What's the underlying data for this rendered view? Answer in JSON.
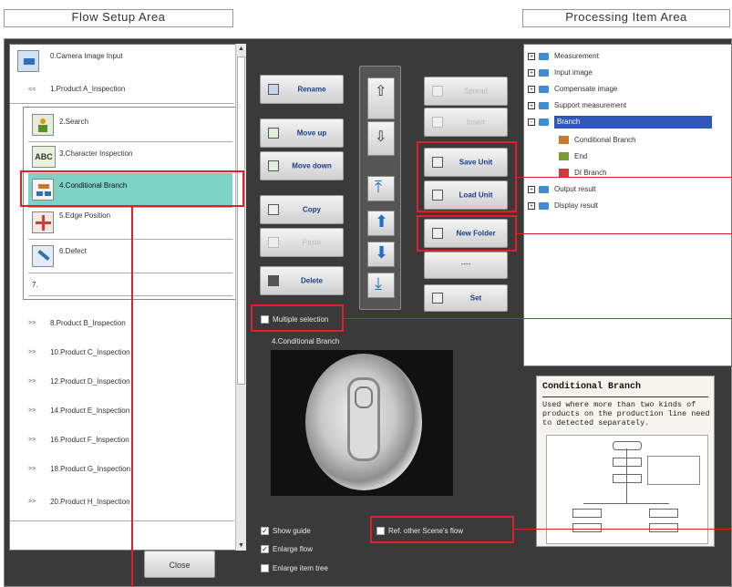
{
  "areas": {
    "flow_setup": "Flow Setup Area",
    "processing_item": "Processing Item Area"
  },
  "flow": {
    "items": [
      {
        "label": "0.Camera Image Input",
        "expander": ""
      },
      {
        "label": "1.Product A_Inspection",
        "expander": "<<"
      },
      {
        "label": "2.Search",
        "expander": ""
      },
      {
        "label": "3.Character Inspection",
        "expander": ""
      },
      {
        "label": "4.Conditional Branch",
        "expander": ""
      },
      {
        "label": "5.Edge Position",
        "expander": ""
      },
      {
        "label": "6.Defect",
        "expander": ""
      },
      {
        "label": "7.",
        "expander": ""
      },
      {
        "label": "8.Product B_Inspection",
        "expander": ">>"
      },
      {
        "label": "10.Product C_Inspection",
        "expander": ">>"
      },
      {
        "label": "12.Product D_Inspection",
        "expander": ">>"
      },
      {
        "label": "14.Product E_Inspection",
        "expander": ">>"
      },
      {
        "label": "16.Product F_Inspection",
        "expander": ">>"
      },
      {
        "label": "18.Product G_Inspection",
        "expander": ">>"
      },
      {
        "label": "20.Product H_Inspection",
        "expander": ">>"
      }
    ],
    "close_label": "Close",
    "icon_abc": "ABC"
  },
  "buttons": {
    "rename": "Rename",
    "move_up": "Move up",
    "move_down": "Move down",
    "copy": "Copy",
    "paste": "Paste",
    "delete": "Delete",
    "spread": "Spread",
    "insert": "Insert",
    "save_unit": "Save Unit",
    "load_unit": "Load Unit",
    "new_folder": "New Folder",
    "separator": "----",
    "set": "Set"
  },
  "options": {
    "multiple_selection": "Multiple selection",
    "show_guide": "Show guide",
    "enlarge_flow": "Enlarge flow",
    "enlarge_item_tree": "Enlarge item tree",
    "ref_other_scene": "Ref. other Scene's flow",
    "show_guide_checked": true,
    "enlarge_flow_checked": true,
    "enlarge_item_tree_checked": false,
    "multiple_selection_checked": false,
    "ref_other_scene_checked": false
  },
  "preview": {
    "title": "4.Conditional Branch"
  },
  "tree": {
    "items": [
      {
        "label": "Measurement",
        "sign": "+"
      },
      {
        "label": "Input image",
        "sign": "+"
      },
      {
        "label": "Compensate image",
        "sign": "+"
      },
      {
        "label": "Support measurement",
        "sign": "+"
      },
      {
        "label": "Branch",
        "sign": "-"
      },
      {
        "label": "Conditional Branch",
        "sign": ""
      },
      {
        "label": "End",
        "sign": ""
      },
      {
        "label": "DI Branch",
        "sign": ""
      },
      {
        "label": "Output result",
        "sign": "+"
      },
      {
        "label": "Display result",
        "sign": "+"
      }
    ]
  },
  "guide": {
    "title": "Conditional Branch",
    "body": "Used where more than two kinds of products on the production line need to detected separately."
  },
  "colors": {
    "selected_row": "#7ed3c7",
    "tree_selected": "#2f57b8",
    "highlight_red": "#e01f26",
    "panel_bg": "#3a3a3a"
  }
}
